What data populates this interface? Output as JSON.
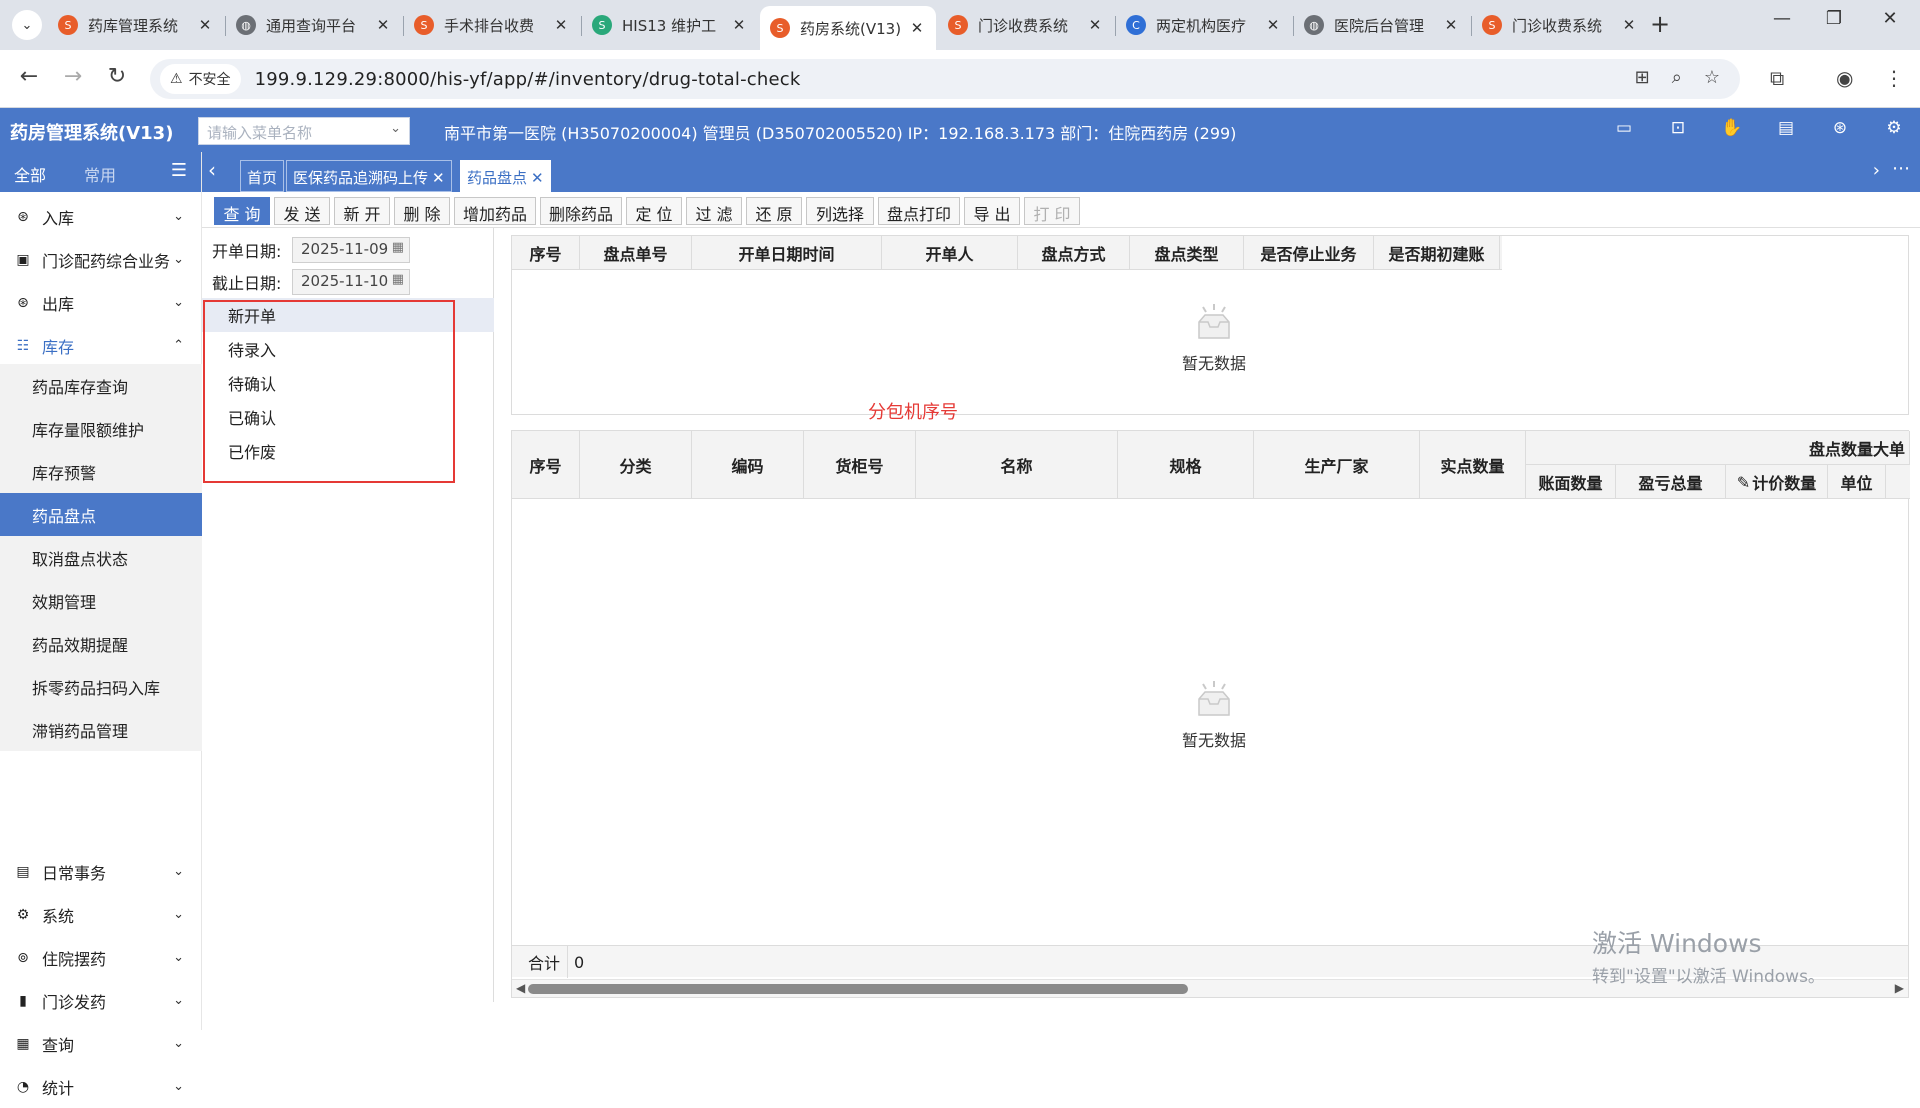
{
  "browser": {
    "tabs": [
      {
        "title": "药库管理系统",
        "fav_color": "#e85d2a",
        "fav_icon": "app-logo-icon"
      },
      {
        "title": "通用查询平台",
        "fav_color": "#6b6f75",
        "fav_icon": "globe-icon"
      },
      {
        "title": "手术排台收费",
        "fav_color": "#e85d2a",
        "fav_icon": "app-logo-icon"
      },
      {
        "title": "HIS13 维护工",
        "fav_color": "#2aa87a",
        "fav_icon": "app-logo-icon"
      },
      {
        "title": "药房系统(V13)",
        "fav_color": "#e85d2a",
        "fav_icon": "app-logo-icon"
      },
      {
        "title": "门诊收费系统",
        "fav_color": "#e85d2a",
        "fav_icon": "app-logo-icon"
      },
      {
        "title": "两定机构医疗",
        "fav_color": "#2f6fd6",
        "fav_icon": "chs-icon"
      },
      {
        "title": "医院后台管理",
        "fav_color": "#6b6f75",
        "fav_icon": "globe-icon"
      },
      {
        "title": "门诊收费系统",
        "fav_color": "#e85d2a",
        "fav_icon": "app-logo-icon"
      }
    ],
    "active_tab_index": 4,
    "security_label": "不安全",
    "url": "199.9.129.29:8000/his-yf/app/#/inventory/drug-total-check"
  },
  "app": {
    "name": "药房管理系统(V13)",
    "menu_search_placeholder": "请输入菜单名称",
    "header_info": "南平市第一医院 (H35070200004) 管理员 (D350702005520) IP：192.168.3.173 部门：住院西药房 (299)",
    "accent_color": "#4a78c8"
  },
  "sidebar": {
    "tab_all": "全部",
    "tab_common": "常用",
    "menus": [
      {
        "label": "入库",
        "icon": "inbound-icon"
      },
      {
        "label": "门诊配药综合业务",
        "icon": "clinic-dispense-icon"
      },
      {
        "label": "出库",
        "icon": "outbound-icon"
      },
      {
        "label": "库存",
        "icon": "inventory-icon"
      },
      {
        "label": "日常事务",
        "icon": "daily-affairs-icon"
      },
      {
        "label": "系统",
        "icon": "system-gear-icon"
      },
      {
        "label": "住院摆药",
        "icon": "inpatient-dispense-icon"
      },
      {
        "label": "门诊发药",
        "icon": "outpatient-dispense-icon"
      },
      {
        "label": "查询",
        "icon": "query-icon"
      },
      {
        "label": "统计",
        "icon": "statistics-icon"
      }
    ],
    "inventory_children": [
      "药品库存查询",
      "库存量限额维护",
      "库存预警",
      "药品盘点",
      "取消盘点状态",
      "效期管理",
      "药品效期提醒",
      "拆零药品扫码入库",
      "滞销药品管理"
    ],
    "selected_child": "药品盘点"
  },
  "page_tabs": [
    {
      "label": "首页"
    },
    {
      "label": "医保药品追溯码上传"
    },
    {
      "label": "药品盘点"
    }
  ],
  "toolbar": {
    "buttons": [
      "查 询",
      "发 送",
      "新 开",
      "删 除",
      "增加药品",
      "删除药品",
      "定 位",
      "过 滤",
      "还 原",
      "列选择",
      "盘点打印",
      "导 出",
      "打 印"
    ]
  },
  "filter": {
    "start_label": "开单日期:",
    "start_value": "2025-11-09",
    "end_label": "截止日期:",
    "end_value": "2025-11-10",
    "statuses": [
      "新开单",
      "待录入",
      "待确认",
      "已确认",
      "已作废"
    ],
    "selected_status": "新开单"
  },
  "annotation": "分包机序号",
  "top_grid": {
    "columns": [
      "序号",
      "盘点单号",
      "开单日期时间",
      "开单人",
      "盘点方式",
      "盘点类型",
      "是否停止业务",
      "是否期初建账"
    ],
    "empty_text": "暂无数据"
  },
  "bottom_grid": {
    "columns": [
      "序号",
      "分类",
      "编码",
      "货柜号",
      "名称",
      "规格",
      "生产厂家",
      "实点数量"
    ],
    "group_header": "盘点数量大单",
    "sub_columns": [
      "账面数量",
      "盈亏总量",
      "计价数量",
      "单位"
    ],
    "empty_text": "暂无数据",
    "footer_label": "合计",
    "footer_value": "0"
  },
  "watermark": {
    "line1": "激活 Windows",
    "line2": "转到\"设置\"以激活 Windows。"
  }
}
